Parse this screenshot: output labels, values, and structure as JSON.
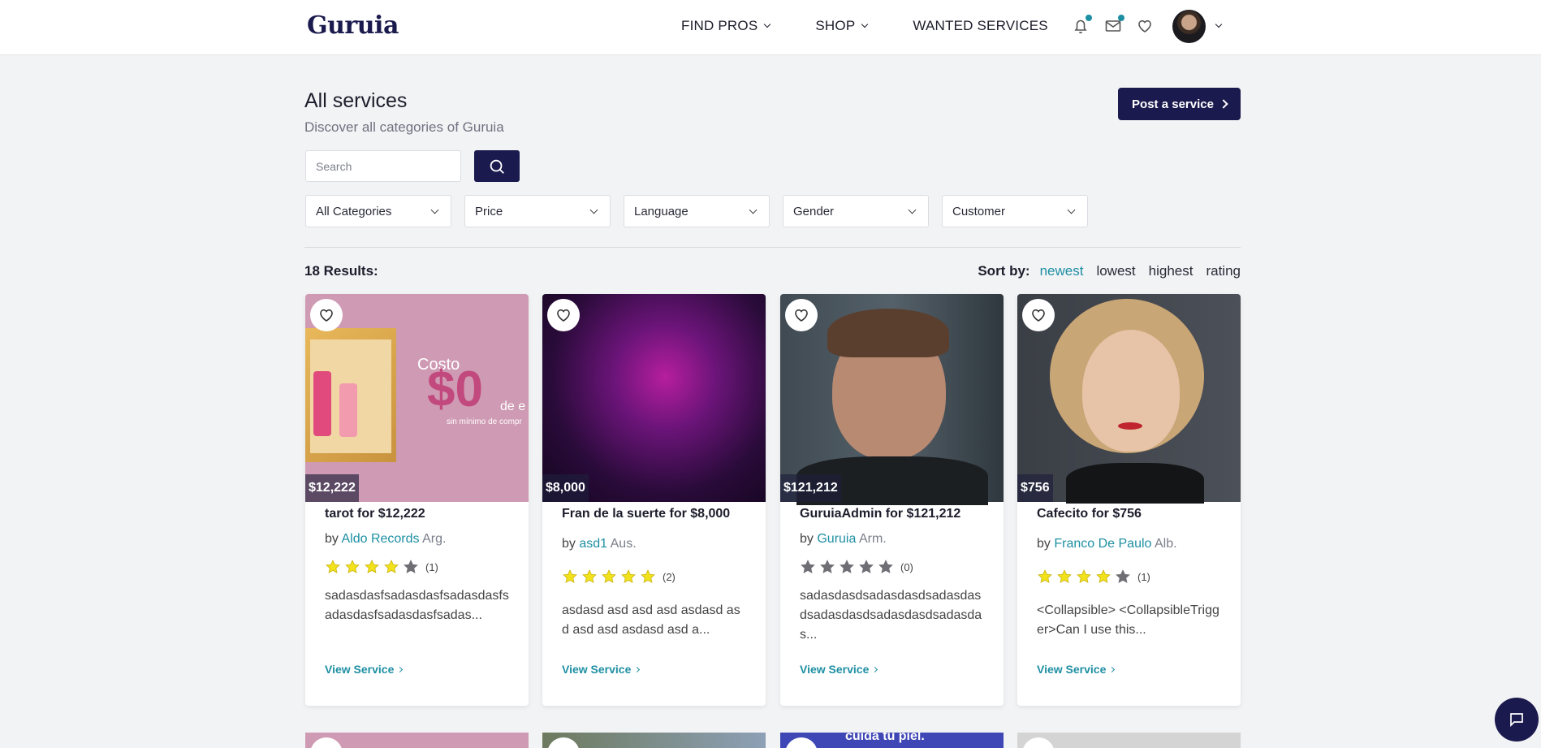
{
  "header": {
    "logo": "Guruia",
    "nav": [
      {
        "label": "FIND PROS",
        "has_dropdown": true
      },
      {
        "label": "SHOP",
        "has_dropdown": true
      },
      {
        "label": "WANTED SERVICES",
        "has_dropdown": false
      }
    ],
    "icons": [
      "bell-icon",
      "mail-icon",
      "heart-icon"
    ],
    "accent_color": "#1e8fa3",
    "brand_color": "#1b1a4e"
  },
  "page": {
    "title": "All services",
    "subtitle": "Discover all categories of Guruia",
    "post_button": "Post a service"
  },
  "search": {
    "placeholder": "Search",
    "value": ""
  },
  "filters": [
    "All Categories",
    "Price",
    "Language",
    "Gender",
    "Customer"
  ],
  "results": {
    "label": "18 Results:"
  },
  "sort": {
    "label": "Sort by:",
    "options": [
      "newest",
      "lowest",
      "highest",
      "rating"
    ],
    "active": "newest"
  },
  "cards": [
    {
      "price": "$12,222",
      "title": "tarot for $12,222",
      "by": "by",
      "author": "Aldo Records",
      "country": "Arg.",
      "rating": 4,
      "review_count": "(1)",
      "description": "sadasdasfsadasdasfsadasdasfsadasdasfsadasdasfsadas...",
      "link": "View Service",
      "image_text": {
        "top": "Costo",
        "big": "$0",
        "small": "de e",
        "tiny": "sin mínimo de compr"
      }
    },
    {
      "price": "$8,000",
      "title": "Fran de la suerte for $8,000",
      "by": "by",
      "author": "asd1",
      "country": "Aus.",
      "rating": 5,
      "review_count": "(2)",
      "description": "asdasd asd asd asd asdasd asd asd asd asdasd asd a...",
      "link": "View Service"
    },
    {
      "price": "$121,212",
      "title": "GuruiaAdmin for $121,212",
      "by": "by",
      "author": "Guruia",
      "country": "Arm.",
      "rating": 0,
      "review_count": "(0)",
      "description": "sadasdasdsadasdasdsadasdasdsadasdasdsadasdasdsadasdas...",
      "link": "View Service"
    },
    {
      "price": "$756",
      "title": "Cafecito for $756",
      "by": "by",
      "author": "Franco De Paulo",
      "country": "Alb.",
      "rating": 4,
      "review_count": "(1)",
      "description": "<Collapsible> <CollapsibleTrigger>Can I use this...",
      "link": "View Service"
    }
  ],
  "peek_row": {
    "text_card3": "cuida tu piel."
  }
}
